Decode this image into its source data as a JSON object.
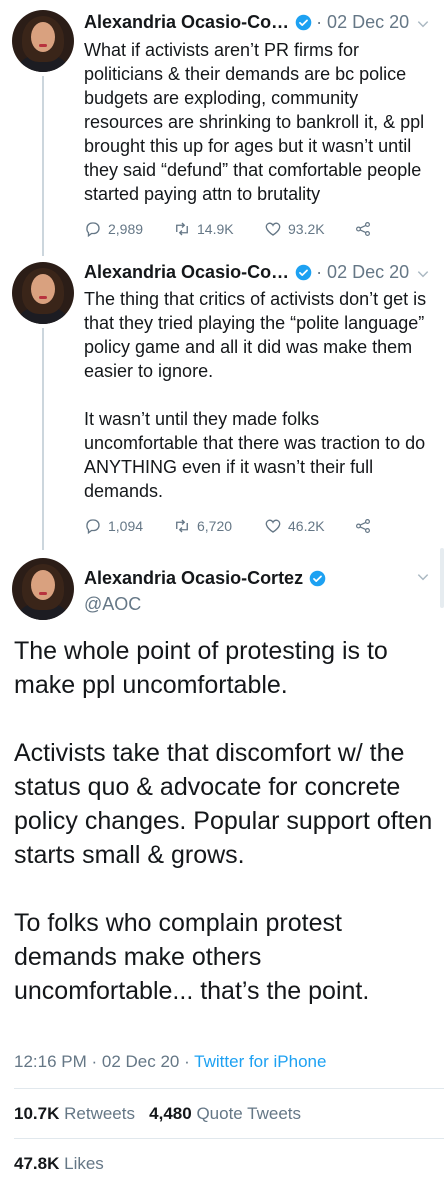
{
  "tweets": [
    {
      "name": "Alexandria Ocasio-Co…",
      "date": "· 02 Dec 20",
      "text": "What if activists aren’t PR firms for politicians & their demands are bc police budgets are exploding, community resources are shrinking to bankroll it, & ppl brought this up for ages but it wasn’t until they said “defund” that comfortable people started paying attn to brutality",
      "replies": "2,989",
      "retweets": "14.9K",
      "likes": "93.2K"
    },
    {
      "name": "Alexandria Ocasio-Co…",
      "date": "· 02 Dec 20",
      "text": "The thing that critics of activists don’t get is that they tried playing the “polite language” policy game and all it did was make them easier to ignore.\n\nIt wasn’t until they made folks uncomfortable that there was traction to do ANYTHING even if it wasn’t their full demands.",
      "replies": "1,094",
      "retweets": "6,720",
      "likes": "46.2K"
    }
  ],
  "main_tweet": {
    "name": "Alexandria Ocasio-Cortez",
    "handle": "@AOC",
    "text": "The whole point of protesting is to make ppl uncomfortable.\n\nActivists take that discomfort w/ the status quo & advocate for concrete policy changes. Popular support often starts small & grows.\n\nTo folks who complain protest demands make others uncomfortable... that’s the point.",
    "time": "12:16 PM · 02 Dec 20 · ",
    "source": "Twitter for iPhone",
    "retweets_count": "10.7K",
    "retweets_label": "Retweets",
    "quotes_count": "4,480",
    "quotes_label": "Quote Tweets",
    "likes_count": "47.8K",
    "likes_label": "Likes"
  },
  "colors": {
    "accent": "#1da1f2",
    "muted": "#657786",
    "text": "#14171a",
    "divider": "#e1e8ed"
  },
  "icons": [
    "verified-icon",
    "chevron-down-icon",
    "reply-icon",
    "retweet-icon",
    "like-icon",
    "share-icon"
  ]
}
